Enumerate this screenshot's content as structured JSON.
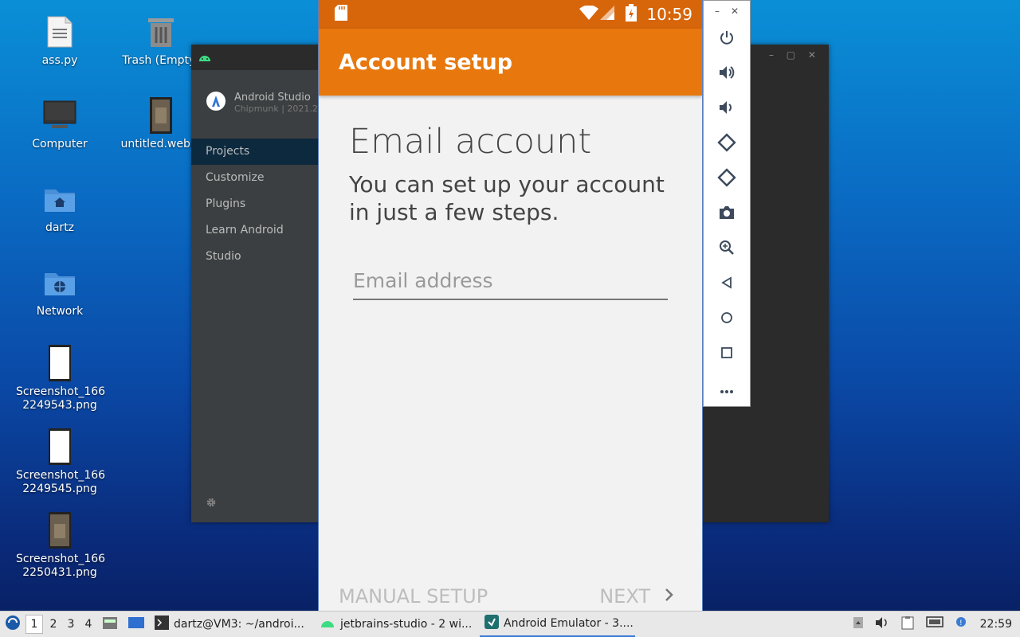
{
  "desktop": {
    "icons": [
      {
        "label": "ass.py"
      },
      {
        "label": "Trash (Empty)"
      },
      {
        "label": "Computer"
      },
      {
        "label": "untitled.webm"
      },
      {
        "label": "dartz"
      },
      {
        "label": "Network"
      },
      {
        "label": "Screenshot_166\n2249543.png"
      },
      {
        "label": "Screenshot_166\n2249545.png"
      },
      {
        "label": "Screenshot_166\n2250431.png"
      }
    ]
  },
  "studio": {
    "app_name": "Android Studio",
    "version": "Chipmunk | 2021.2",
    "nav": [
      "Projects",
      "Customize",
      "Plugins",
      "Learn Android Studio"
    ]
  },
  "phone": {
    "time": "10:59",
    "appbar_title": "Account setup",
    "heading": "Email account",
    "subheading": "You can set up your account in just a few steps.",
    "email_placeholder": "Email address",
    "email_value": "",
    "manual_setup_label": "MANUAL SETUP",
    "next_label": "NEXT"
  },
  "taskbar": {
    "workspaces": [
      "1",
      "2",
      "3",
      "4"
    ],
    "tasks": [
      {
        "label": "dartz@VM3: ~/androi..."
      },
      {
        "label": "jetbrains-studio - 2 wi..."
      },
      {
        "label": "Android Emulator - 3...."
      }
    ],
    "clock": "22:59"
  },
  "colors": {
    "appbar": "#e8780e",
    "statusbar": "#d7650a",
    "studio_active": "#0d293e"
  }
}
